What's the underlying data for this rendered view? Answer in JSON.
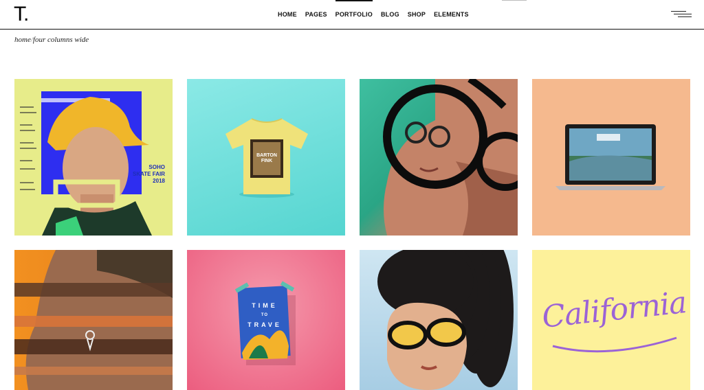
{
  "header": {
    "logo": "T.",
    "nav": [
      "HOME",
      "PAGES",
      "PORTFOLIO",
      "BLOG",
      "SHOP",
      "ELEMENTS"
    ],
    "active_nav": "PORTFOLIO"
  },
  "breadcrumb": {
    "home": "home",
    "separator": "/",
    "current": "four columns wide"
  },
  "portfolio": {
    "items": [
      {
        "image": "fashion-poster-yellow-hat",
        "poster_text": [
          "SOHO",
          "SKATE FAIR",
          "2018"
        ]
      },
      {
        "image": "yellow-tshirt-mockup",
        "shirt_text": [
          "BARTON",
          "FINK"
        ]
      },
      {
        "image": "woman-round-glasses-closeup"
      },
      {
        "image": "laptop-mockup-peach"
      },
      {
        "image": "man-profile-glitch-orange"
      },
      {
        "image": "travel-poster-pink",
        "poster_text": [
          "TIME",
          "TO",
          "TRAVE"
        ]
      },
      {
        "image": "woman-yellow-sunglasses-repeat"
      },
      {
        "image": "california-lettering",
        "lettering": "California"
      }
    ]
  },
  "colors": {
    "accent": "#111111",
    "tile_yellow": "#e7ec8a",
    "tile_cyan": "#6fe0dc",
    "tile_peach": "#f5b98e",
    "tile_pink": "#ec5d7f",
    "tile_lemon": "#fdf19a",
    "lettering_purple": "#9b63d6"
  }
}
